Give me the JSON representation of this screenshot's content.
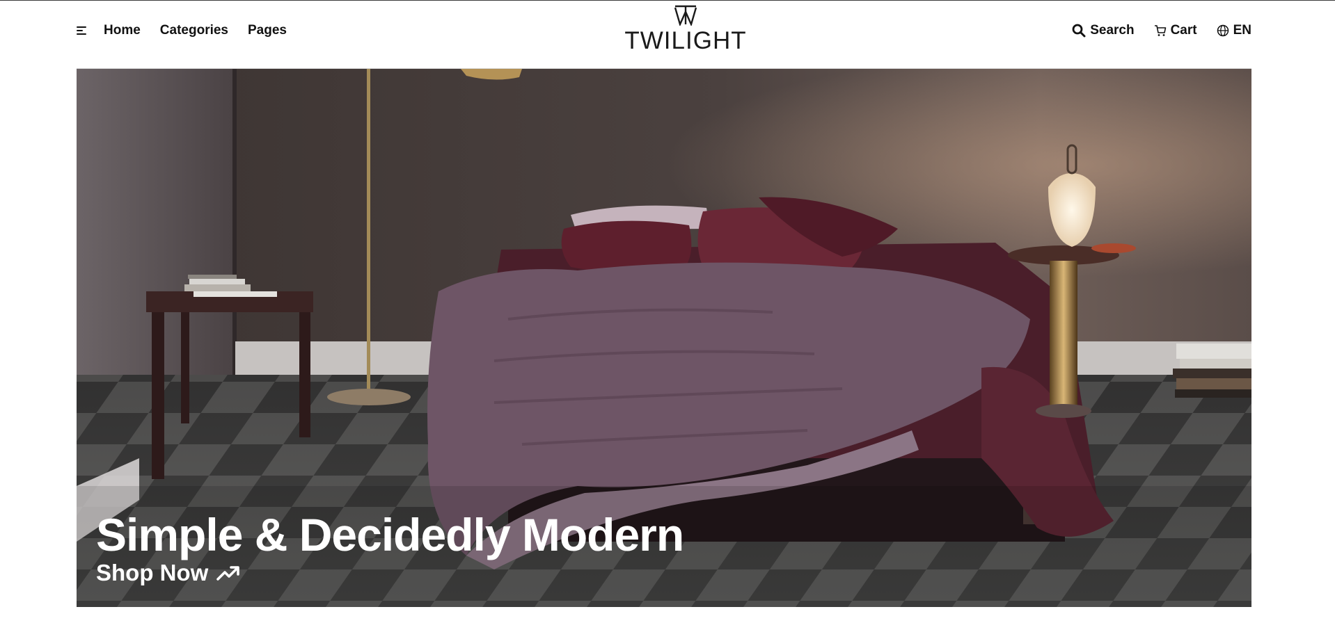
{
  "header": {
    "nav": [
      {
        "label": "Home"
      },
      {
        "label": "Categories"
      },
      {
        "label": "Pages"
      }
    ],
    "logo_text": "TWILIGHT",
    "actions": {
      "search_label": "Search",
      "cart_label": "Cart",
      "language_label": "EN"
    },
    "icons": {
      "menu": "menu-icon",
      "search": "search-icon",
      "cart": "cart-icon",
      "language": "globe-icon",
      "arrow": "trending-up-arrow-icon"
    }
  },
  "hero": {
    "title": "Simple & Decidedly Modern",
    "cta_label": "Shop Now",
    "image_subject": "bedroom-photo"
  },
  "colors": {
    "text": "#111111",
    "hero_text": "#ffffff",
    "blanket": "#6e5566",
    "bedding": "#5a2533",
    "wall": "#4b413f"
  }
}
